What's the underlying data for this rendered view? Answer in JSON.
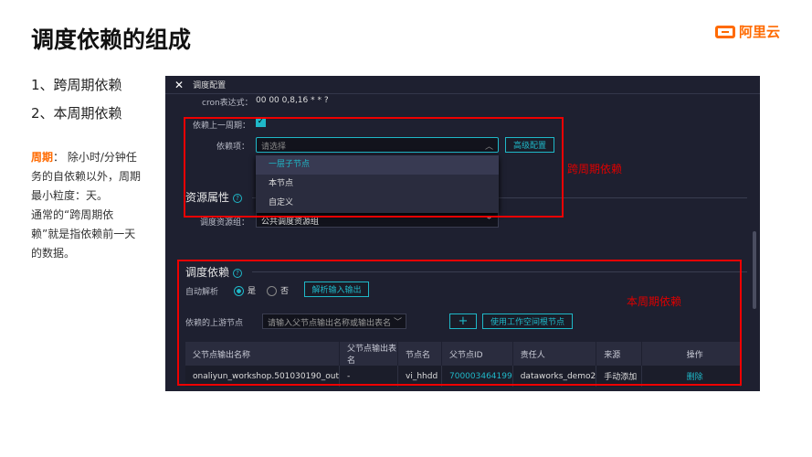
{
  "slide": {
    "title": "调度依赖的组成",
    "logo": "阿里云",
    "items": [
      "1、跨周期依赖",
      "2、本周期依赖"
    ],
    "desc_highlight": "周期",
    "desc_colon": "：",
    "desc_text": " 除小时/分钟任务的自依赖以外，周期最小粒度：天。",
    "desc_text2": "通常的“跨周期依赖”就是指依赖前一天的数据。",
    "annotation_cross": "跨周期依赖",
    "annotation_current": "本周期依赖"
  },
  "panel": {
    "title": "调度配置",
    "cron_label": "cron表达式：",
    "cron_value": "00 00 0,8,16 * * ?",
    "depend_prev_label": "依赖上一周期：",
    "depend_item_label": "依赖项：",
    "depend_item_placeholder": "请选择",
    "advanced_button": "高级配置",
    "dropdown_options": [
      "一层子节点",
      "本节点",
      "自定义"
    ],
    "resource_section": "资源属性",
    "resource_group_label": "调度资源组：",
    "resource_group_value": "公共调度资源组",
    "dependency_section": "调度依赖",
    "auto_parse_label": "自动解析",
    "radio_yes": "是",
    "radio_no": "否",
    "parse_button": "解析输入输出",
    "upstream_label": "依赖的上游节点",
    "upstream_placeholder": "请输入父节点输出名称或输出表名",
    "add_button": "+",
    "root_button": "使用工作空间根节点",
    "table": {
      "headers": [
        "父节点输出名称",
        "父节点输出表名",
        "节点名",
        "父节点ID",
        "责任人",
        "来源",
        "操作"
      ],
      "rows": [
        [
          "onaliyun_workshop.501030190_out",
          "-",
          "vi_hhdd",
          "700003464199",
          "dataworks_demo2",
          "手动添加",
          "删除"
        ]
      ]
    }
  },
  "colors": {
    "accent": "#1fb8c8",
    "brand": "#ff6a00",
    "highlight": "#e00000"
  }
}
